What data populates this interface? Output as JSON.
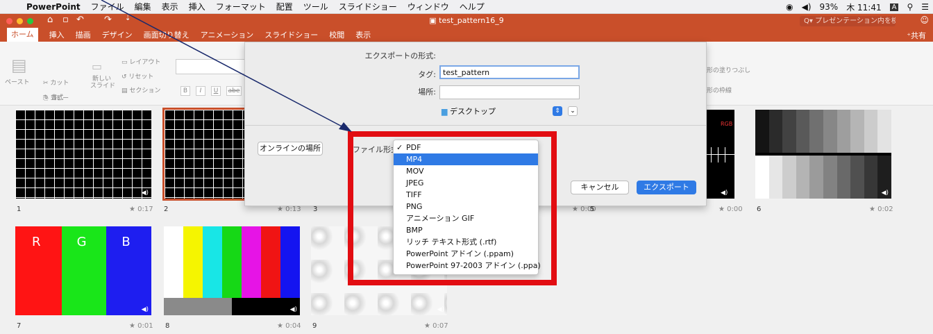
{
  "menubar": {
    "apple_icon": "apple-logo",
    "app_name": "PowerPoint",
    "items": [
      "ファイル",
      "編集",
      "表示",
      "挿入",
      "フォーマット",
      "配置",
      "ツール",
      "スライドショー",
      "ウィンドウ",
      "ヘルプ"
    ],
    "status": {
      "battery": "93%",
      "clock": "木 11:41"
    }
  },
  "window": {
    "title": "test_pattern16_9",
    "search_placeholder": "プレゼンテーション内を検索",
    "share_label": "共有",
    "tabs": [
      "ホーム",
      "挿入",
      "描画",
      "デザイン",
      "画面切り替え",
      "アニメーション",
      "スライドショー",
      "校閲",
      "表示"
    ]
  },
  "ribbon": {
    "paste": "ペースト",
    "cut": "カット",
    "copy": "コピー",
    "format": "書式",
    "new_slide_1": "新しい",
    "new_slide_2": "スライド",
    "layout": "レイアウト",
    "reset": "リセット",
    "section": "セクション",
    "bold": "B",
    "italic": "I",
    "underline": "U",
    "strike": "abe",
    "shape_fill": "形の塗りつぶし",
    "shape_outline": "形の枠線"
  },
  "slides": [
    {
      "num": "1",
      "time": "0:17"
    },
    {
      "num": "2",
      "time": "0:13"
    },
    {
      "num": "3",
      "time": ""
    },
    {
      "num": "",
      "time": "0:00"
    },
    {
      "num": "5",
      "time": "0:00"
    },
    {
      "num": "6",
      "time": "0:02"
    },
    {
      "num": "7",
      "time": "0:01"
    },
    {
      "num": "8",
      "time": "0:04"
    },
    {
      "num": "9",
      "time": "0:07"
    }
  ],
  "rgb_labels": [
    "R",
    "G",
    "B"
  ],
  "rgb_mini": "RGB",
  "dialog": {
    "export_as_label": "エクスポートの形式:",
    "export_as_value": "test_pattern",
    "tags_label": "タグ:",
    "tags_value": "",
    "where_label": "場所:",
    "where_value": "デスクトップ",
    "online_button": "オンラインの場所",
    "file_format_label": "ファイル形式",
    "cancel_button": "キャンセル",
    "export_button": "エクスポート"
  },
  "dropdown": {
    "checked_item": "PDF",
    "selected_item": "MP4",
    "options": [
      "PDF",
      "MP4",
      "MOV",
      "JPEG",
      "TIFF",
      "PNG",
      "アニメーション GIF",
      "BMP",
      "リッチ テキスト形式 (.rtf)",
      "PowerPoint アドイン (.ppam)",
      "PowerPoint 97-2003 アドイン (.ppa)"
    ]
  },
  "colors": {
    "accent": "#c94f2a",
    "highlight": "#2f7ae5",
    "annotation_red": "#e20d12",
    "arrow": "#1a2a6c"
  }
}
